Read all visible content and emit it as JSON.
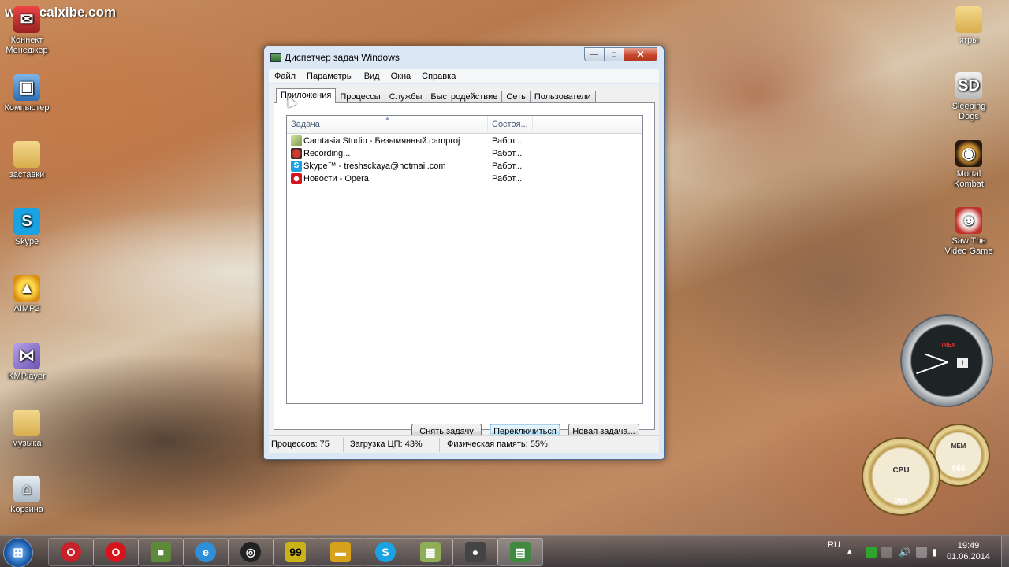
{
  "desktop": {
    "watermark": "www.calxibe.com",
    "left_icons": [
      {
        "label": "Коннект Менеджер",
        "icon": "connect-manager-icon",
        "glyph": "✉"
      },
      {
        "label": "Компьютер",
        "icon": "computer-icon",
        "glyph": "▣"
      },
      {
        "label": "заставки",
        "icon": "folder-icon",
        "glyph": ""
      },
      {
        "label": "Skype",
        "icon": "skype-icon",
        "glyph": "S"
      },
      {
        "label": "AIMP2",
        "icon": "aimp-icon",
        "glyph": "▲"
      },
      {
        "label": "KMPlayer",
        "icon": "kmplayer-icon",
        "glyph": "⋈"
      },
      {
        "label": "музыка",
        "icon": "folder-icon",
        "glyph": ""
      },
      {
        "label": "Корзина",
        "icon": "recycle-bin-icon",
        "glyph": "🗑"
      }
    ],
    "right_icons": [
      {
        "label": "игры",
        "icon": "folder-icon",
        "glyph": ""
      },
      {
        "label": "Sleeping Dogs",
        "icon": "sleeping-dogs-icon",
        "glyph": "SD"
      },
      {
        "label": "Mortal Kombat",
        "icon": "mortal-kombat-icon",
        "glyph": "◉"
      },
      {
        "label": "Saw The Video Game",
        "icon": "saw-icon",
        "glyph": "☻"
      }
    ],
    "gadgets": {
      "cpu_label": "CPU",
      "cpu_value": "053",
      "mem_label": "MEM",
      "mem_value": "056",
      "clock_brand": "TIMEX",
      "clock_day": "1"
    }
  },
  "window": {
    "title": "Диспетчер задач Windows",
    "controls": {
      "minimize": "—",
      "maximize": "□",
      "close": "✕"
    },
    "menu": [
      "Файл",
      "Параметры",
      "Вид",
      "Окна",
      "Справка"
    ],
    "tabs": [
      "Приложения",
      "Процессы",
      "Службы",
      "Быстродействие",
      "Сеть",
      "Пользователи"
    ],
    "active_tab": "Приложения",
    "columns": {
      "task": "Задача",
      "status": "Состоя..."
    },
    "rows": [
      {
        "name": "Camtasia Studio - Безымянный.camproj",
        "status": "Работ...",
        "icon": "camtasia-icon"
      },
      {
        "name": "Recording...",
        "status": "Работ...",
        "icon": "recording-icon"
      },
      {
        "name": "Skype™ - treshsckaya@hotmail.com",
        "status": "Работ...",
        "icon": "skype-icon"
      },
      {
        "name": "Новости - Opera",
        "status": "Работ...",
        "icon": "opera-icon"
      }
    ],
    "buttons": {
      "end_task": "Снять задачу",
      "switch_to": "Переключиться",
      "new_task": "Новая задача..."
    },
    "status": {
      "processes": "Процессов: 75",
      "cpu": "Загрузка ЦП: 43%",
      "memory": "Физическая память: 55%"
    }
  },
  "taskbar": {
    "items": [
      {
        "icon": "opera-next-icon",
        "glyph": "O",
        "color": "#c9212a"
      },
      {
        "icon": "opera-icon",
        "glyph": "O",
        "color": "#d4151c"
      },
      {
        "icon": "minecraft-icon",
        "glyph": "■",
        "color": "#5d8a3a"
      },
      {
        "icon": "internet-explorer-icon",
        "glyph": "e",
        "color": "#2d8fd8"
      },
      {
        "icon": "obs-icon",
        "glyph": "◎",
        "color": "#222222"
      },
      {
        "icon": "nfs-icon",
        "glyph": "99",
        "color": "#c9b317"
      },
      {
        "icon": "car-game-icon",
        "glyph": "▬",
        "color": "#d7a21b"
      },
      {
        "icon": "skype-icon",
        "glyph": "S",
        "color": "#19a3e3"
      },
      {
        "icon": "camtasia-icon",
        "glyph": "▦",
        "color": "#8fae55"
      },
      {
        "icon": "recorder-icon",
        "glyph": "●",
        "color": "#444444"
      },
      {
        "icon": "task-manager-icon",
        "glyph": "▤",
        "color": "#3f8a3f"
      }
    ],
    "tray": {
      "language": "RU",
      "time": "19:49",
      "date": "01.06.2014"
    }
  }
}
